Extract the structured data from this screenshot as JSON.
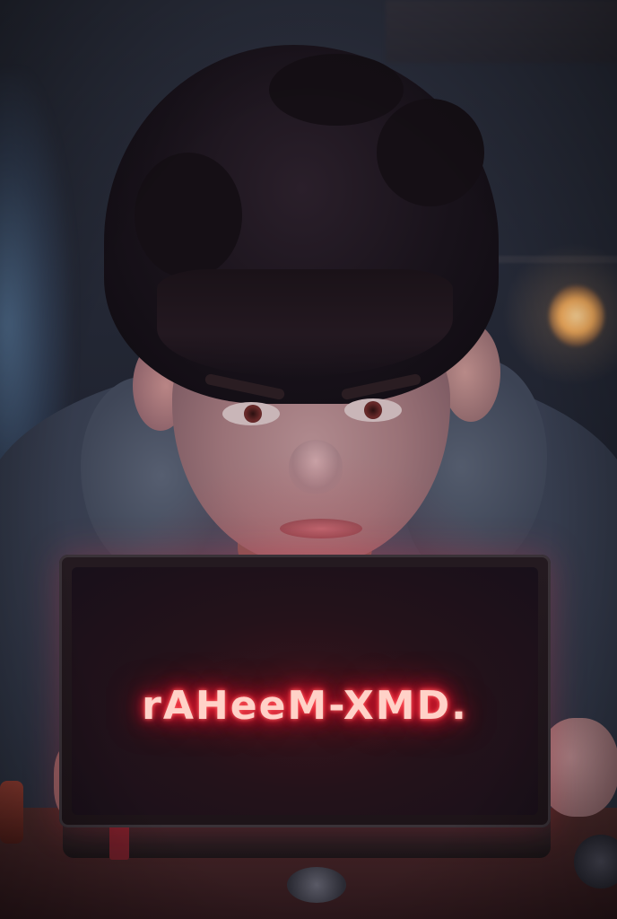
{
  "photo": {
    "screen_text": "rAHeeM-XMD."
  }
}
